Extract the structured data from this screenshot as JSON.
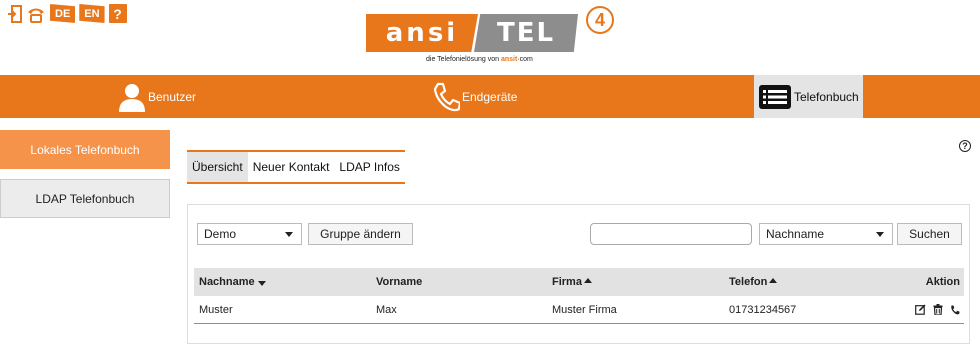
{
  "colors": {
    "accent": "#e8761b",
    "accent_light": "#f5934a",
    "logo_gray": "#8d8d8d"
  },
  "top_icons": [
    {
      "name": "logout-icon"
    },
    {
      "name": "phone-icon"
    },
    {
      "name": "lang-de",
      "label": "DE"
    },
    {
      "name": "lang-en",
      "label": "EN"
    },
    {
      "name": "help-icon",
      "label": "?"
    }
  ],
  "logo": {
    "part1": "ansi",
    "part2": "TEL",
    "version": "4",
    "tagline_prefix": "die Telefonielösung von ",
    "tagline_brand": "ansit",
    "tagline_suffix": "·com"
  },
  "nav": {
    "benutzer": "Benutzer",
    "endgeraete": "Endgeräte",
    "telefonbuch": "Telefonbuch"
  },
  "sidebar": {
    "items": [
      {
        "label": "Lokales Telefonbuch",
        "active": true
      },
      {
        "label": "LDAP Telefonbuch",
        "active": false
      }
    ]
  },
  "help": "?",
  "tabs": [
    {
      "label": "Übersicht",
      "active": true
    },
    {
      "label": "Neuer Kontakt",
      "active": false
    },
    {
      "label": "LDAP Infos",
      "active": false
    }
  ],
  "toolbar": {
    "group_value": "Demo",
    "group_change_label": "Gruppe ändern",
    "search_value": "",
    "search_field_value": "Nachname",
    "search_label": "Suchen"
  },
  "table": {
    "headers": [
      "Nachname",
      "Vorname",
      "Firma",
      "Telefon",
      "Aktion"
    ],
    "rows": [
      {
        "nachname": "Muster",
        "vorname": "Max",
        "firma": "Muster Firma",
        "telefon": "01731234567"
      }
    ]
  }
}
